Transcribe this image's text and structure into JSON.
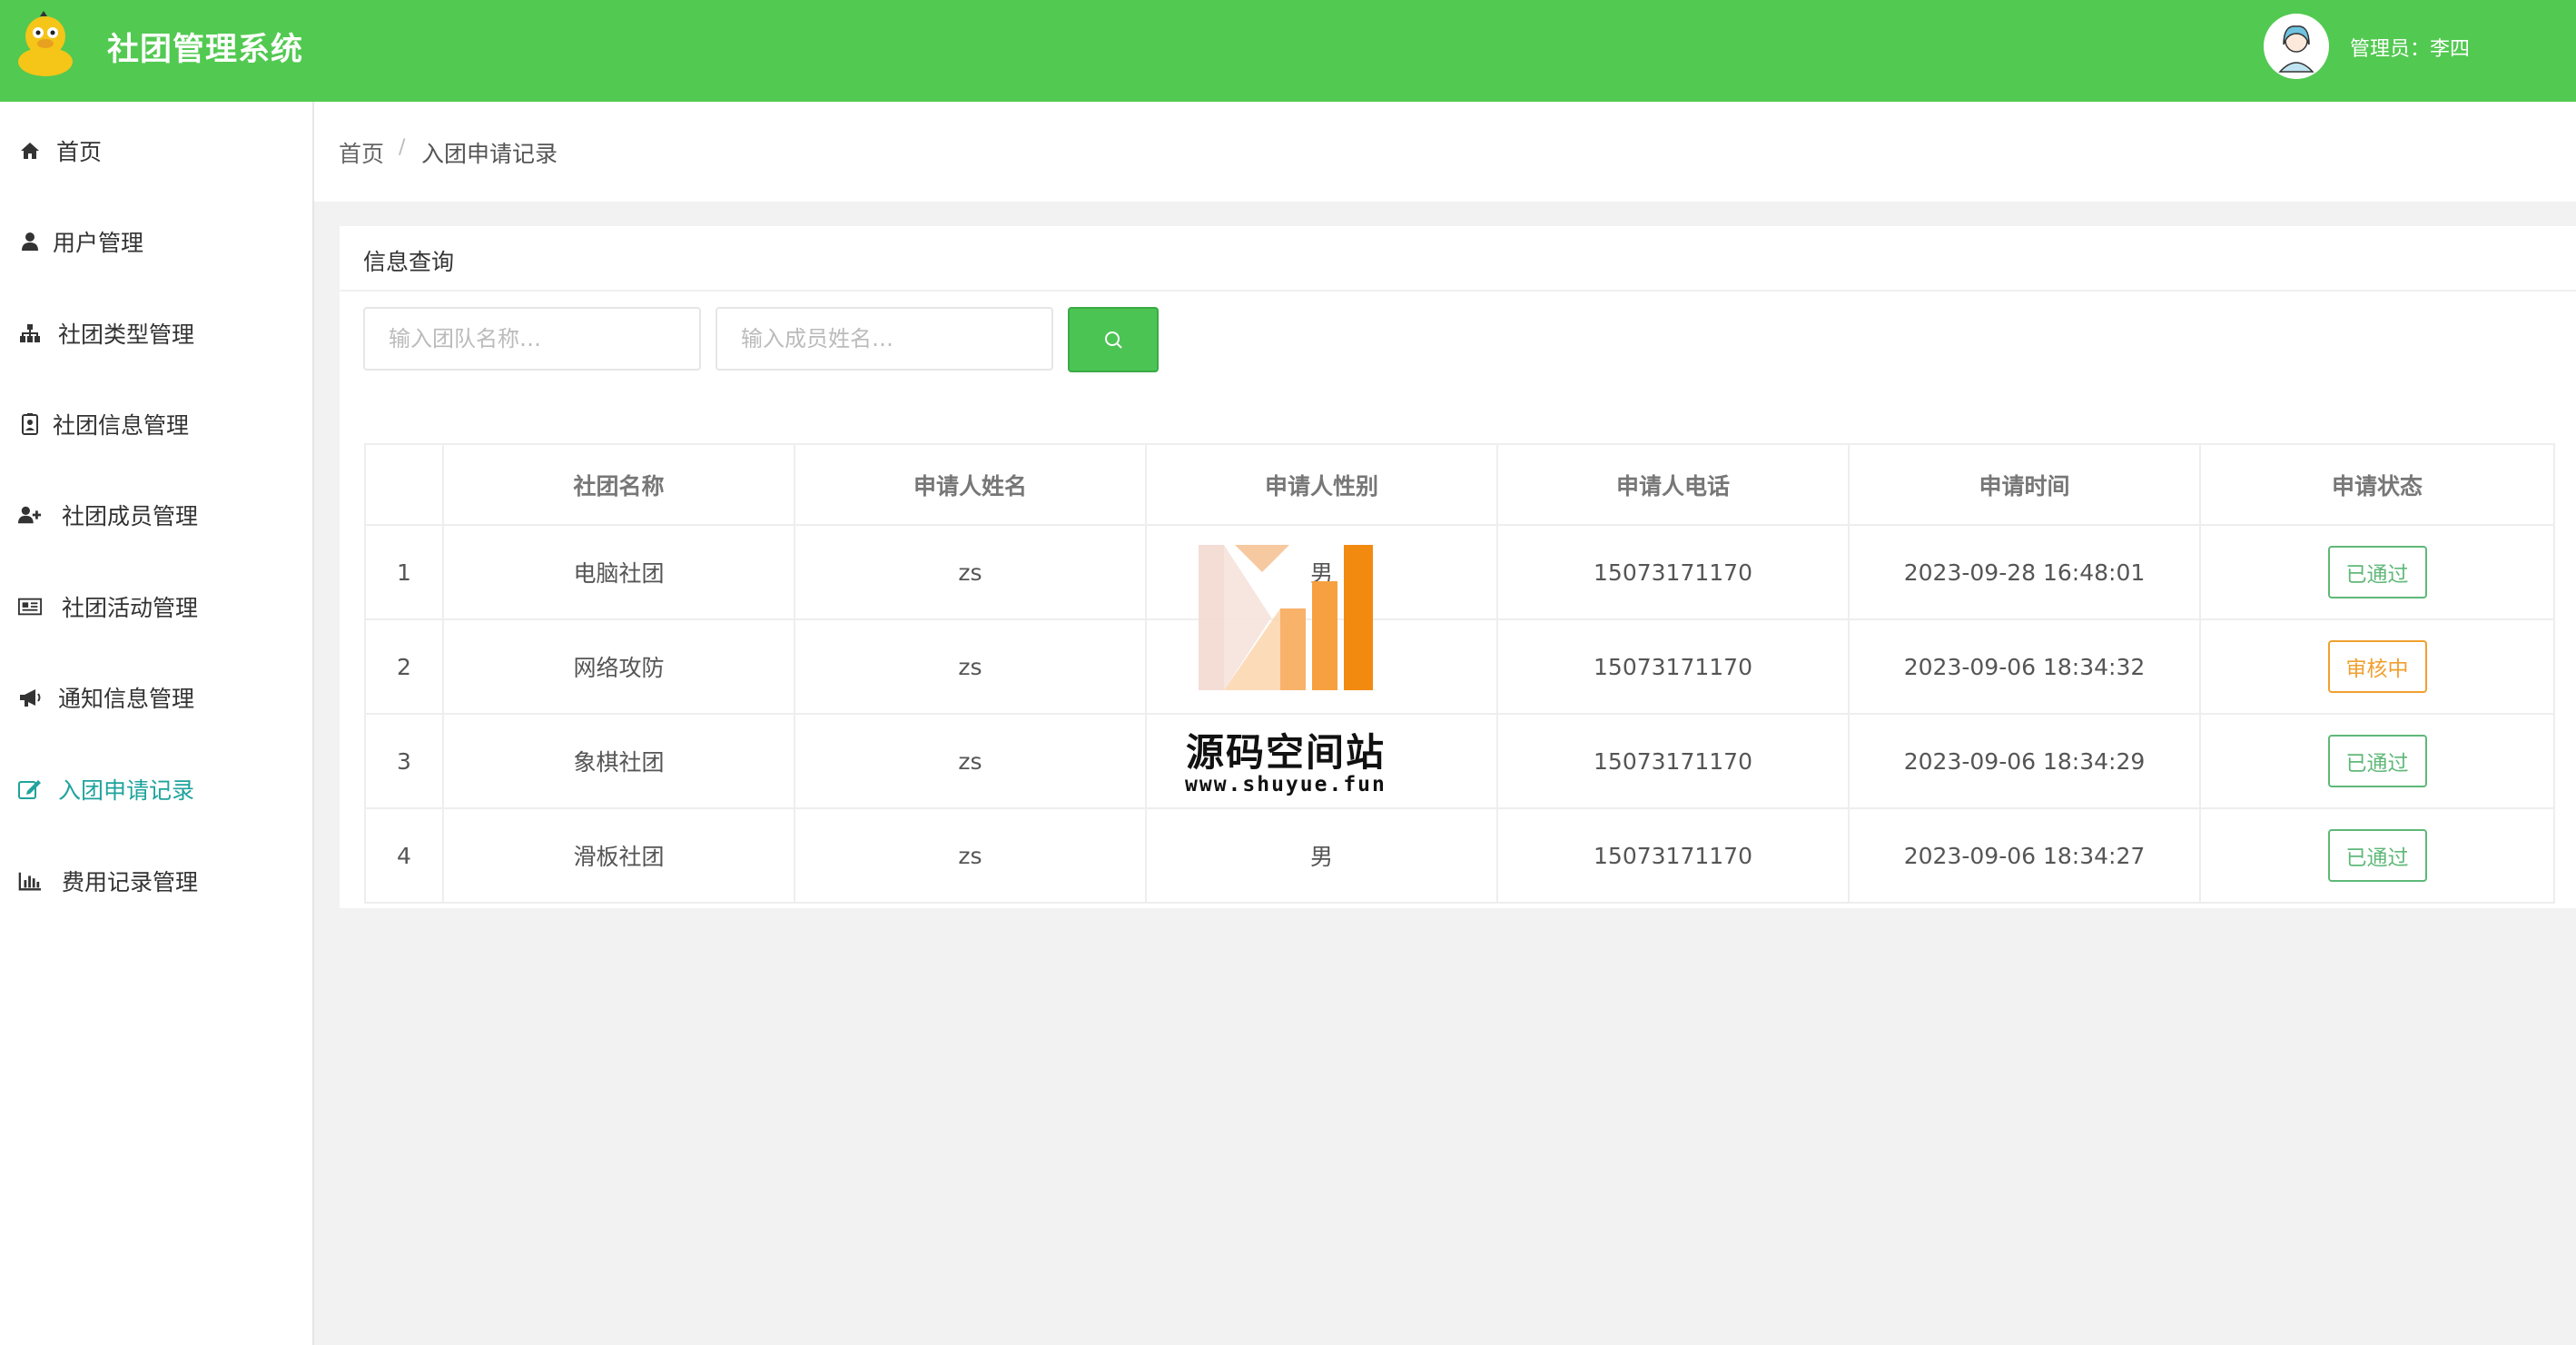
{
  "app": {
    "title": "社团管理系统",
    "admin_label": "管理员：李四"
  },
  "sidebar": {
    "items": [
      {
        "label": "首页",
        "icon": "home-icon"
      },
      {
        "label": "用户管理",
        "icon": "user-icon"
      },
      {
        "label": "社团类型管理",
        "icon": "sitemap-icon"
      },
      {
        "label": "社团信息管理",
        "icon": "id-card-icon"
      },
      {
        "label": "社团成员管理",
        "icon": "user-plus-icon"
      },
      {
        "label": "社团活动管理",
        "icon": "newspaper-icon"
      },
      {
        "label": "通知信息管理",
        "icon": "bullhorn-icon"
      },
      {
        "label": "入团申请记录",
        "icon": "edit-icon",
        "active": true
      },
      {
        "label": "费用记录管理",
        "icon": "bar-chart-icon"
      }
    ]
  },
  "breadcrumb": {
    "home": "首页",
    "separator": "/",
    "current": "入团申请记录"
  },
  "search": {
    "title": "信息查询",
    "team_placeholder": "输入团队名称…",
    "member_placeholder": "输入成员姓名…",
    "button_icon": "search-icon"
  },
  "table": {
    "columns": [
      "",
      "社团名称",
      "申请人姓名",
      "申请人性别",
      "申请人电话",
      "申请时间",
      "申请状态"
    ],
    "rows": [
      {
        "index": "1",
        "club": "电脑社团",
        "name": "zs",
        "gender": "男",
        "phone": "15073171170",
        "time": "2023-09-28 16:48:01",
        "status": "已通过",
        "status_color": "#5fb878"
      },
      {
        "index": "2",
        "club": "网络攻防",
        "name": "zs",
        "gender": "",
        "phone": "15073171170",
        "time": "2023-09-06 18:34:32",
        "status": "审核中",
        "status_color": "#f0a030"
      },
      {
        "index": "3",
        "club": "象棋社团",
        "name": "zs",
        "gender": "",
        "phone": "15073171170",
        "time": "2023-09-06 18:34:29",
        "status": "已通过",
        "status_color": "#5fb878"
      },
      {
        "index": "4",
        "club": "滑板社团",
        "name": "zs",
        "gender": "男",
        "phone": "15073171170",
        "time": "2023-09-06 18:34:27",
        "status": "已通过",
        "status_color": "#5fb878"
      }
    ]
  },
  "watermark": {
    "text": "源码空间站",
    "url": "www.shuyue.fun"
  },
  "colors": {
    "header": "#52c951",
    "accent": "#1fa39c",
    "search_button": "#4bc454"
  }
}
